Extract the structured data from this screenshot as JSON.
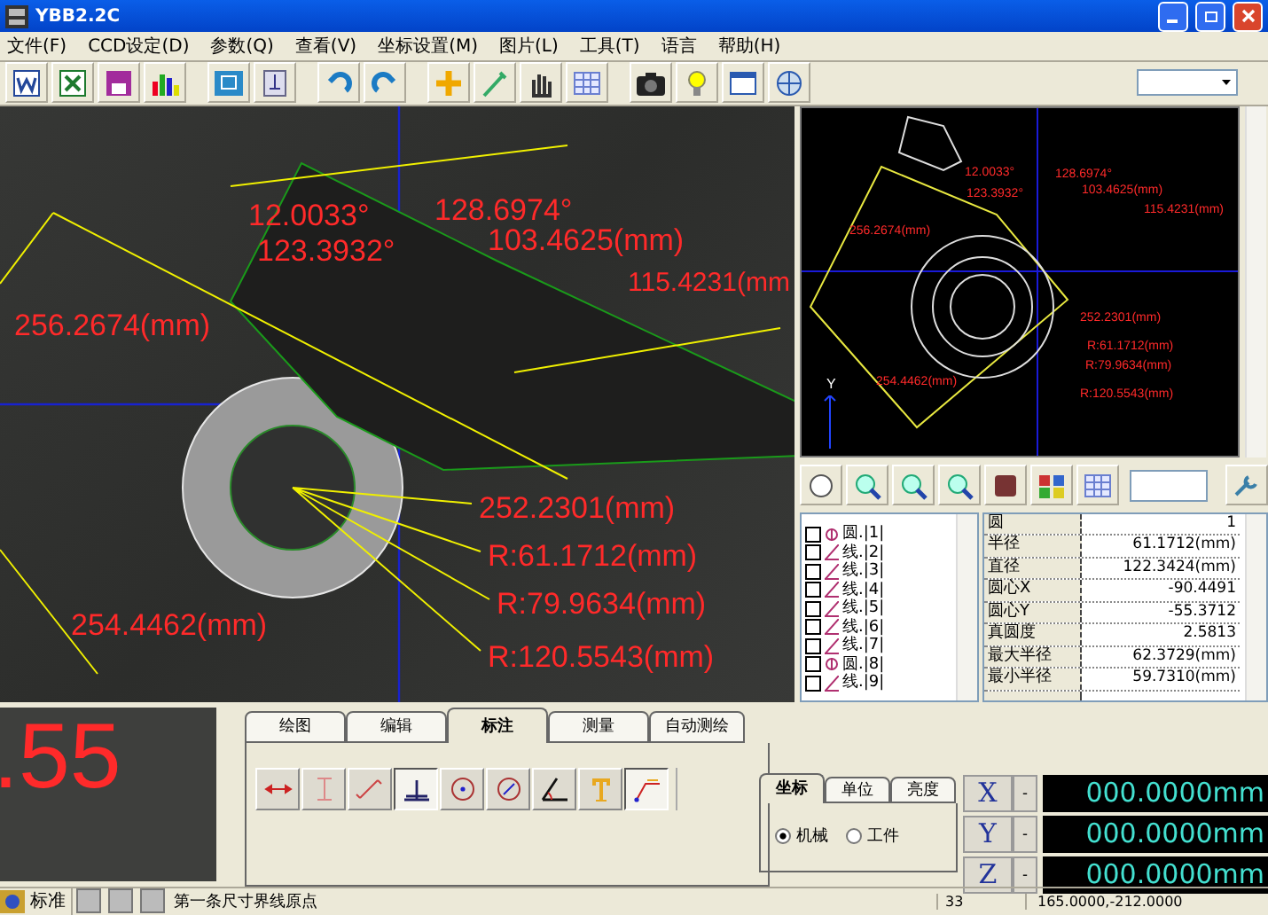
{
  "window": {
    "title": "YBB2.2C"
  },
  "menu": [
    "文件(F)",
    "CCD设定(D)",
    "参数(Q)",
    "查看(V)",
    "坐标设置(M)",
    "图片(L)",
    "工具(T)",
    "语言",
    "帮助(H)"
  ],
  "camera_view": {
    "annotations": [
      "12.0033°",
      "128.6974°",
      "123.3932°",
      "103.4625(mm)",
      "115.4231(mm",
      "256.2674(mm)",
      "252.2301(mm)",
      "R:61.1712(mm)",
      "R:79.9634(mm)",
      "254.4462(mm)",
      "R:120.5543(mm)"
    ]
  },
  "preview": {
    "axis_label": "Y",
    "annotations": [
      "12.0033°",
      "128.6974°",
      "123.3932°",
      "103.4625(mm)",
      "115.4231(mm)",
      "256.2674(mm)",
      "252.2301(mm)",
      "R:61.1712(mm)",
      "R:79.9634(mm)",
      "254.4462(mm)",
      "R:120.5543(mm)"
    ]
  },
  "object_list": [
    {
      "kind": "circle",
      "label": "圆.|1|",
      "checked": false
    },
    {
      "kind": "line",
      "label": "线.|2|",
      "checked": false
    },
    {
      "kind": "line",
      "label": "线.|3|",
      "checked": false
    },
    {
      "kind": "line",
      "label": "线.|4|",
      "checked": false
    },
    {
      "kind": "line",
      "label": "线.|5|",
      "checked": false
    },
    {
      "kind": "line",
      "label": "线.|6|",
      "checked": false
    },
    {
      "kind": "line",
      "label": "线.|7|",
      "checked": false
    },
    {
      "kind": "circle",
      "label": "圆.|8|",
      "checked": false
    },
    {
      "kind": "line",
      "label": "线.|9|",
      "checked": false
    }
  ],
  "properties": [
    {
      "name": "圆",
      "value": "1"
    },
    {
      "name": "半径",
      "value": "61.1712(mm)"
    },
    {
      "name": "直径",
      "value": "122.3424(mm)"
    },
    {
      "name": "圆心X",
      "value": "-90.4491"
    },
    {
      "name": "圆心Y",
      "value": "-55.3712"
    },
    {
      "name": "真圆度",
      "value": "2.5813"
    },
    {
      "name": "最大半径",
      "value": "62.3729(mm)"
    },
    {
      "name": "最小半径",
      "value": "59.7310(mm)"
    }
  ],
  "readout": ".55",
  "draw_tabs": [
    {
      "label": "绘图",
      "selected": false
    },
    {
      "label": "编辑",
      "selected": false
    },
    {
      "label": "标注",
      "selected": true
    },
    {
      "label": "测量",
      "selected": false
    },
    {
      "label": "自动测绘",
      "selected": false
    }
  ],
  "tools": [
    {
      "kind": "horizontal",
      "selected": false
    },
    {
      "kind": "vertical",
      "selected": false
    },
    {
      "kind": "aligned",
      "selected": false
    },
    {
      "kind": "baseline",
      "selected": true
    },
    {
      "kind": "radius",
      "selected": false
    },
    {
      "kind": "diameter",
      "selected": false
    },
    {
      "kind": "angle",
      "selected": false
    },
    {
      "kind": "text",
      "selected": false
    },
    {
      "kind": "leader",
      "selected": true
    }
  ],
  "coord_tabs": [
    {
      "label": "坐标",
      "selected": true
    },
    {
      "label": "单位",
      "selected": false
    },
    {
      "label": "亮度",
      "selected": false
    }
  ],
  "coord_mode": [
    {
      "label": "机械",
      "selected": true
    },
    {
      "label": "工件",
      "selected": false
    }
  ],
  "axes": [
    {
      "axis": "X",
      "step": "-",
      "value": "000.0000mm"
    },
    {
      "axis": "Y",
      "step": "-",
      "value": "000.0000mm"
    },
    {
      "axis": "Z",
      "step": "-",
      "value": "000.0000mm"
    }
  ],
  "status_bar": {
    "mode": "标准",
    "message": "第一条尺寸界线原点",
    "code": "33",
    "position": "165.0000,-212.0000"
  }
}
